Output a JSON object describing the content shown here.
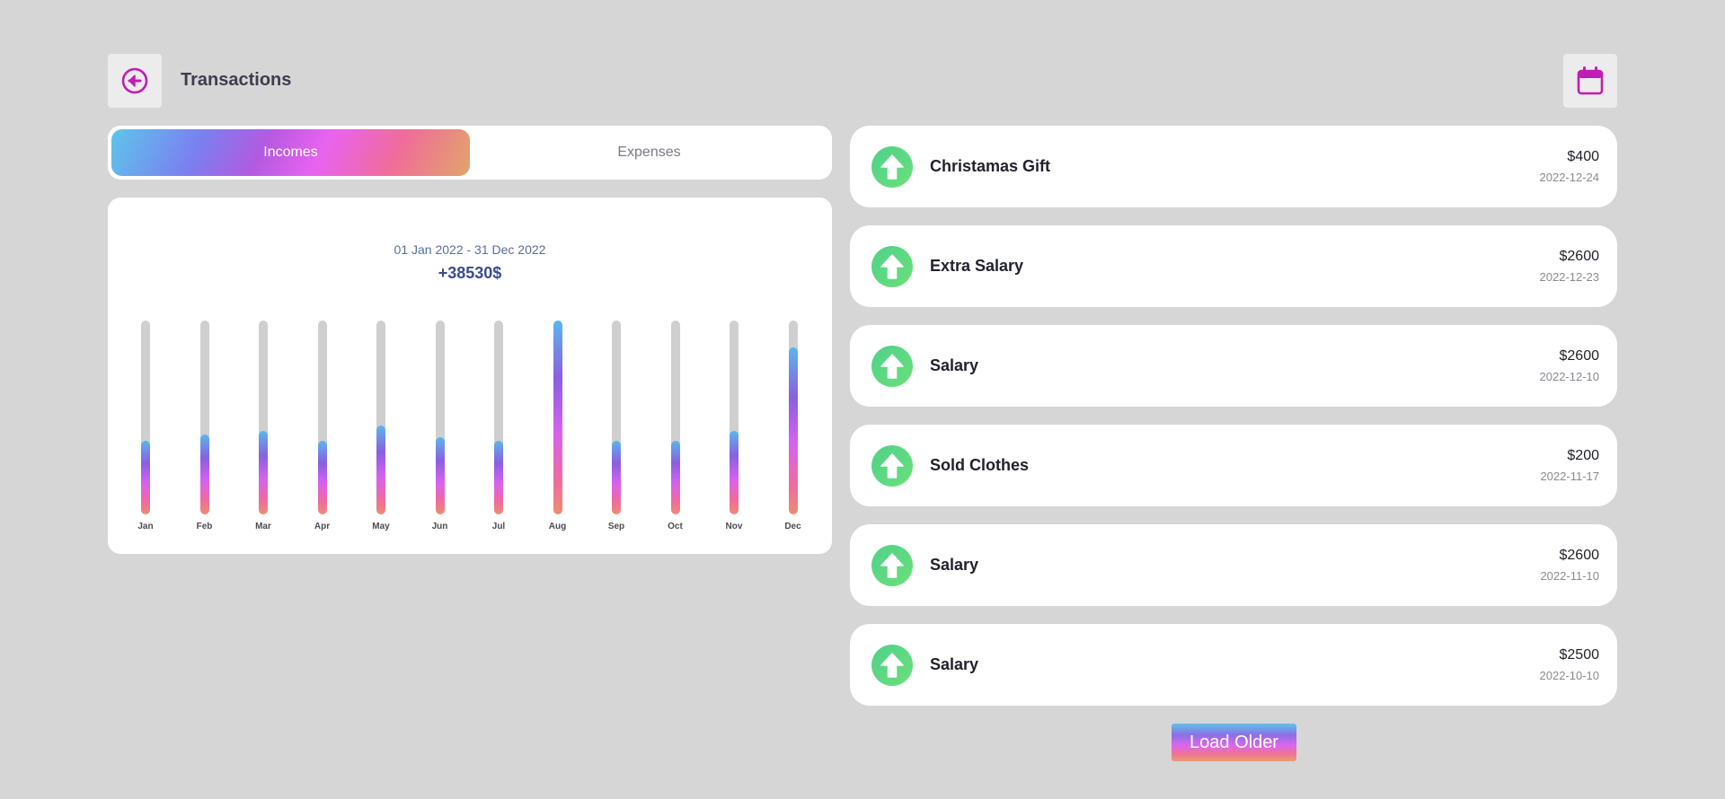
{
  "header": {
    "title": "Transactions",
    "back_icon": "back-arrow-circle-icon",
    "calendar_icon": "calendar-icon",
    "accent_color": "#c21cb1"
  },
  "tabs": [
    {
      "label": "Incomes",
      "active": true
    },
    {
      "label": "Expenses",
      "active": false
    }
  ],
  "summary": {
    "date_range": "01 Jan 2022 - 31 Dec 2022",
    "total": "+38530$"
  },
  "chart_data": {
    "type": "bar",
    "categories": [
      "Jan",
      "Feb",
      "Mar",
      "Apr",
      "May",
      "Jun",
      "Jul",
      "Aug",
      "Sep",
      "Oct",
      "Nov",
      "Dec"
    ],
    "values": [
      0.38,
      0.41,
      0.43,
      0.38,
      0.46,
      0.4,
      0.38,
      1.0,
      0.38,
      0.38,
      0.43,
      0.86
    ],
    "value_unit": "fraction of maximum month"
  },
  "transactions": [
    {
      "name": "Christamas Gift",
      "amount": "$400",
      "date": "2022-12-24",
      "icon": "arrow-up-icon"
    },
    {
      "name": "Extra Salary",
      "amount": "$2600",
      "date": "2022-12-23",
      "icon": "arrow-up-icon"
    },
    {
      "name": "Salary",
      "amount": "$2600",
      "date": "2022-12-10",
      "icon": "arrow-up-icon"
    },
    {
      "name": "Sold Clothes",
      "amount": "$200",
      "date": "2022-11-17",
      "icon": "arrow-up-icon"
    },
    {
      "name": "Salary",
      "amount": "$2600",
      "date": "2022-11-10",
      "icon": "arrow-up-icon"
    },
    {
      "name": "Salary",
      "amount": "$2500",
      "date": "2022-10-10",
      "icon": "arrow-up-icon"
    }
  ],
  "load_older_label": "Load Older"
}
